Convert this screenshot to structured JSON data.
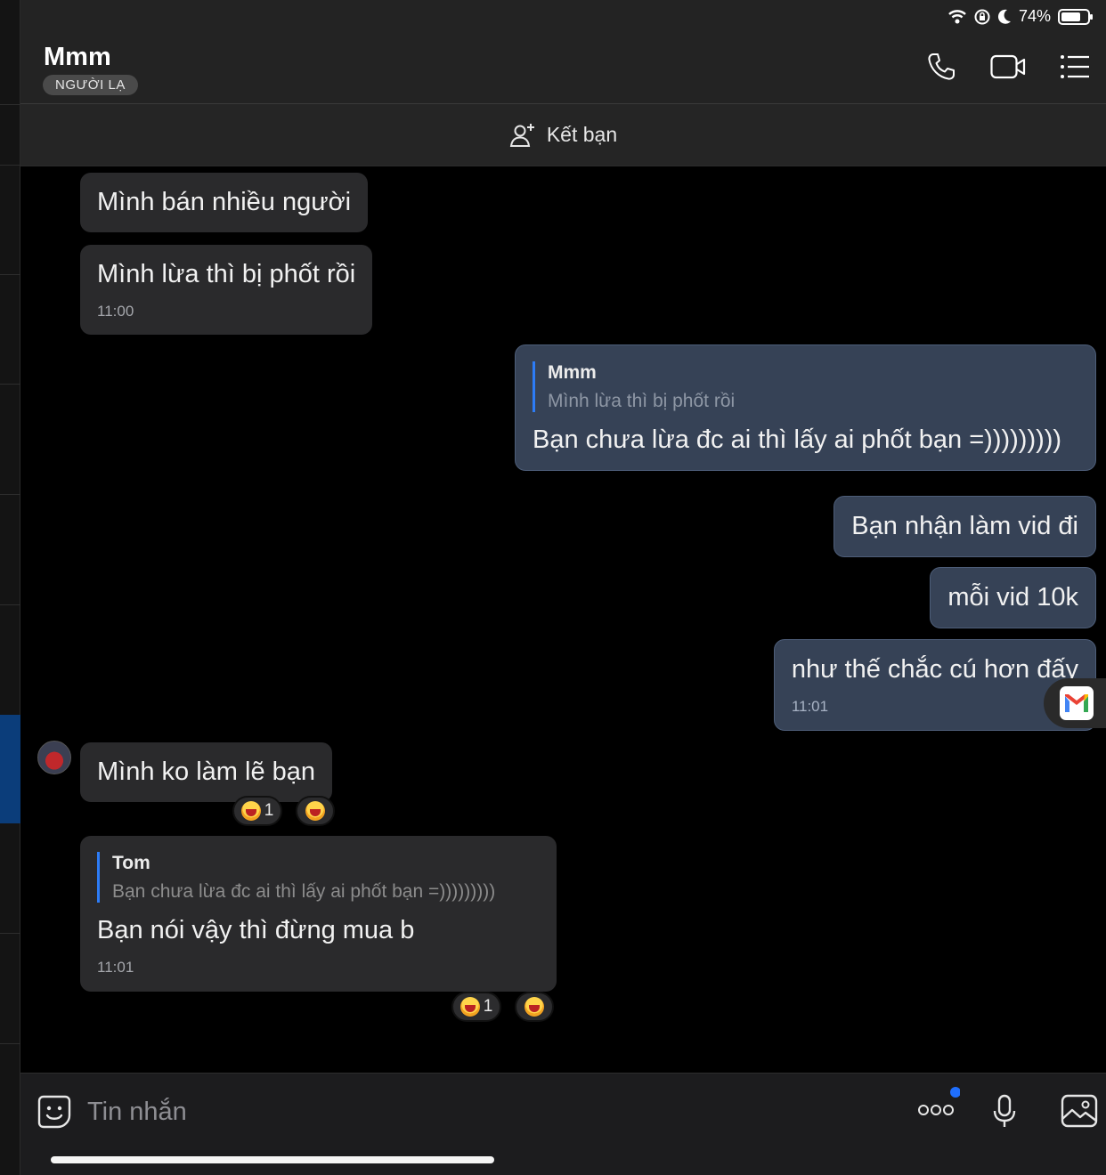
{
  "status": {
    "battery": "74%"
  },
  "header": {
    "title": "Mmm",
    "badge": "NGƯỜI LẠ"
  },
  "add_friend": {
    "label": "Kết bạn"
  },
  "messages": {
    "m1": {
      "text": "Mình bán nhiều người"
    },
    "m2": {
      "text": "Mình lừa thì bị phốt rồi",
      "time": "11:00"
    },
    "m3": {
      "quote_name": "Mmm",
      "quote_text": "Mình lừa thì bị phốt rồi",
      "text": "Bạn chưa lừa đc ai thì lấy ai phốt bạn =)))))))))"
    },
    "m4": {
      "text": "Bạn nhận làm vid đi"
    },
    "m5": {
      "text": "mỗi vid 10k"
    },
    "m6": {
      "text": "như thế chắc cú hơn đấy",
      "time": "11:01"
    },
    "m7": {
      "text": "Mình ko làm lẽ bạn",
      "reaction_count": "1"
    },
    "m8": {
      "quote_name": "Tom",
      "quote_text": "Bạn chưa lừa đc ai thì lấy ai phốt bạn =)))))))))",
      "text": "Bạn nói vậy thì đừng mua b",
      "time": "11:01",
      "reaction_count": "1"
    }
  },
  "composer": {
    "placeholder": "Tin nhắn"
  },
  "colors": {
    "accent": "#2d7cf6",
    "outgoing_bubble": "#364256",
    "incoming_bubble": "#2a2a2c"
  },
  "icons": [
    "wifi-icon",
    "orientation-lock-icon",
    "moon-icon",
    "battery-icon",
    "phone-icon",
    "video-call-icon",
    "menu-list-icon",
    "add-friend-icon",
    "laugh-emoji-icon",
    "gmail-icon",
    "sticker-icon",
    "more-icon",
    "microphone-icon",
    "image-icon"
  ]
}
